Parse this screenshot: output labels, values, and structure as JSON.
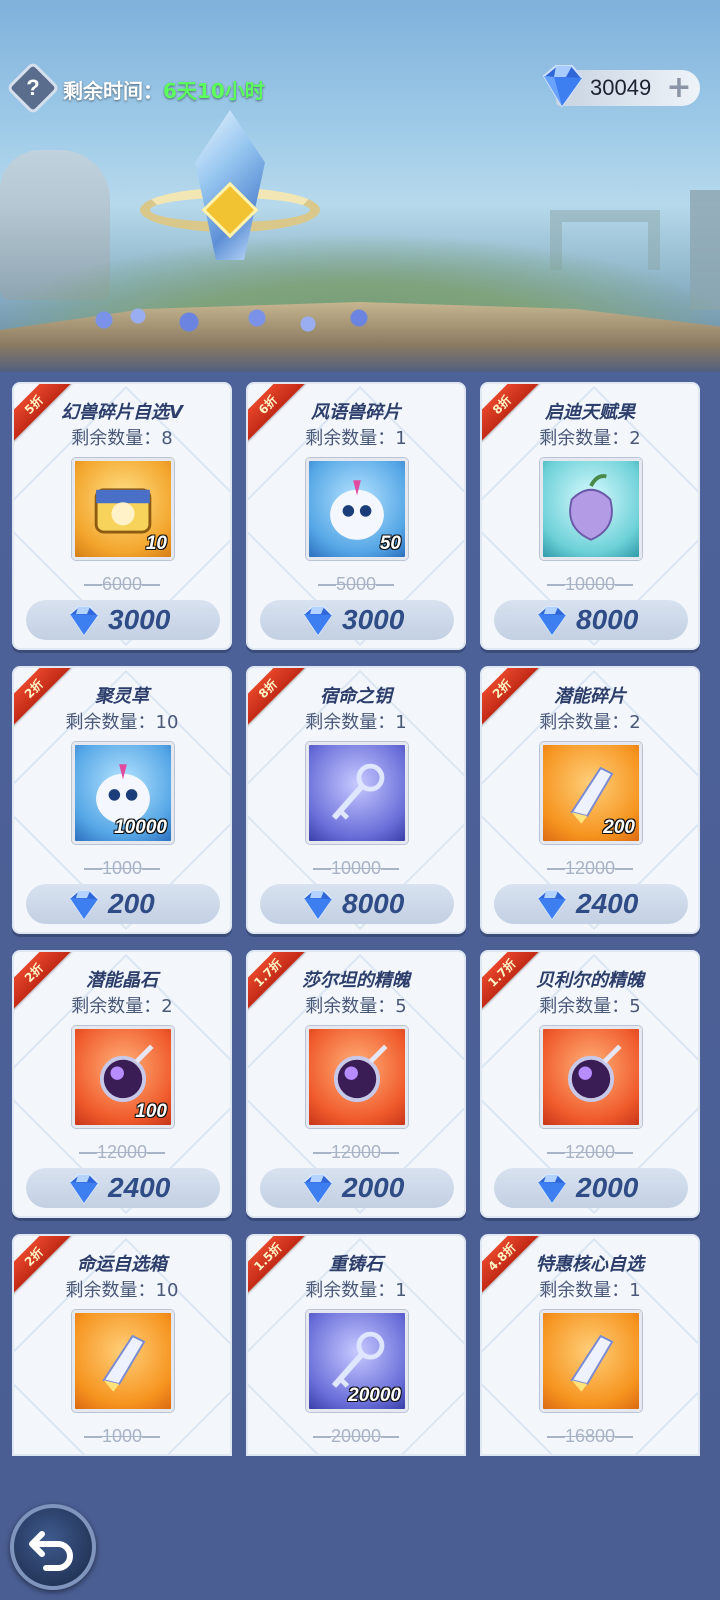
{
  "header": {
    "timer_label": "剩余时间：",
    "timer_value": "6天10小时",
    "currency_amount": "30049",
    "help_glyph": "?",
    "plus_glyph": "+"
  },
  "items": [
    {
      "discount": "5折",
      "name": "幻兽碎片自选V",
      "remain": "剩余数量：8",
      "qty": "10",
      "old_price": "6000",
      "price": "3000",
      "theme": "gold"
    },
    {
      "discount": "6折",
      "name": "风语兽碎片",
      "remain": "剩余数量：1",
      "qty": "50",
      "old_price": "5000",
      "price": "3000",
      "theme": "blue"
    },
    {
      "discount": "8折",
      "name": "启迪天赋果",
      "remain": "剩余数量：2",
      "qty": "",
      "old_price": "10000",
      "price": "8000",
      "theme": "teal"
    },
    {
      "discount": "2折",
      "name": "聚灵草",
      "remain": "剩余数量：10",
      "qty": "10000",
      "old_price": "1000",
      "price": "200",
      "theme": "blue"
    },
    {
      "discount": "8折",
      "name": "宿命之钥",
      "remain": "剩余数量：1",
      "qty": "",
      "old_price": "10000",
      "price": "8000",
      "theme": "purple"
    },
    {
      "discount": "2折",
      "name": "潜能碎片",
      "remain": "剩余数量：2",
      "qty": "200",
      "old_price": "12000",
      "price": "2400",
      "theme": "orange"
    },
    {
      "discount": "2折",
      "name": "潜能晶石",
      "remain": "剩余数量：2",
      "qty": "100",
      "old_price": "12000",
      "price": "2400",
      "theme": "red"
    },
    {
      "discount": "1.7折",
      "name": "莎尔坦的精魄",
      "remain": "剩余数量：5",
      "qty": "",
      "old_price": "12000",
      "price": "2000",
      "theme": "red"
    },
    {
      "discount": "1.7折",
      "name": "贝利尔的精魄",
      "remain": "剩余数量：5",
      "qty": "",
      "old_price": "12000",
      "price": "2000",
      "theme": "red"
    },
    {
      "discount": "2折",
      "name": "命运自选箱",
      "remain": "剩余数量：10",
      "qty": "",
      "old_price": "1000",
      "price": "",
      "theme": "orange"
    },
    {
      "discount": "1.5折",
      "name": "重铸石",
      "remain": "剩余数量：1",
      "qty": "20000",
      "old_price": "20000",
      "price": "",
      "theme": "purple"
    },
    {
      "discount": "4.8折",
      "name": "特惠核心自选",
      "remain": "剩余数量：1",
      "qty": "",
      "old_price": "16800",
      "price": "",
      "theme": "orange"
    }
  ],
  "icons": {
    "help": "help-icon",
    "currency": "diamond-icon",
    "add": "plus-icon",
    "back": "back-arrow-icon"
  },
  "colors": {
    "timer_value": "#5cff5c",
    "ribbon": "#d8361f",
    "price_text": "#2f4c86",
    "card_bg": "#f3f7fc"
  }
}
